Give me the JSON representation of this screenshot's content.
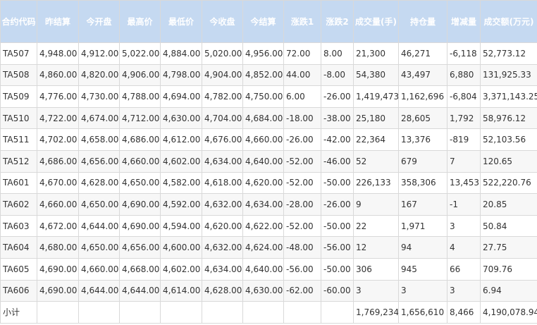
{
  "colors": {
    "header_bg": "#c5d9f1",
    "header_text": "#ffffff",
    "border": "#d9d9d9",
    "alt_row": "#f7f7f7"
  },
  "headers": [
    "合约代码",
    "昨结算",
    "今开盘",
    "最高价",
    "最低价",
    "今收盘",
    "今结算",
    "涨跌1",
    "涨跌2",
    "成交量(手)",
    "持仓量",
    "增减量",
    "成交额(万元)"
  ],
  "rows": [
    [
      "TA507",
      "4,948.00",
      "4,912.00",
      "5,022.00",
      "4,884.00",
      "5,020.00",
      "4,956.00",
      "72.00",
      "8.00",
      "21,300",
      "46,271",
      "-6,118",
      "52,773.12"
    ],
    [
      "TA508",
      "4,860.00",
      "4,820.00",
      "4,906.00",
      "4,798.00",
      "4,904.00",
      "4,852.00",
      "44.00",
      "-8.00",
      "54,380",
      "43,497",
      "6,880",
      "131,925.33"
    ],
    [
      "TA509",
      "4,776.00",
      "4,730.00",
      "4,788.00",
      "4,694.00",
      "4,782.00",
      "4,750.00",
      "6.00",
      "-26.00",
      "1,419,473",
      "1,162,696",
      "-6,804",
      "3,371,143.25"
    ],
    [
      "TA510",
      "4,722.00",
      "4,674.00",
      "4,712.00",
      "4,630.00",
      "4,704.00",
      "4,684.00",
      "-18.00",
      "-38.00",
      "25,180",
      "28,605",
      "1,792",
      "58,976.12"
    ],
    [
      "TA511",
      "4,702.00",
      "4,658.00",
      "4,686.00",
      "4,612.00",
      "4,676.00",
      "4,660.00",
      "-26.00",
      "-42.00",
      "22,364",
      "13,376",
      "-819",
      "52,103.56"
    ],
    [
      "TA512",
      "4,686.00",
      "4,656.00",
      "4,660.00",
      "4,602.00",
      "4,634.00",
      "4,640.00",
      "-52.00",
      "-46.00",
      "52",
      "679",
      "7",
      "120.65"
    ],
    [
      "TA601",
      "4,670.00",
      "4,628.00",
      "4,650.00",
      "4,582.00",
      "4,618.00",
      "4,620.00",
      "-52.00",
      "-50.00",
      "226,133",
      "358,306",
      "13,453",
      "522,220.76"
    ],
    [
      "TA602",
      "4,660.00",
      "4,650.00",
      "4,690.00",
      "4,592.00",
      "4,632.00",
      "4,634.00",
      "-28.00",
      "-26.00",
      "9",
      "167",
      "-1",
      "20.85"
    ],
    [
      "TA603",
      "4,672.00",
      "4,644.00",
      "4,690.00",
      "4,594.00",
      "4,620.00",
      "4,622.00",
      "-52.00",
      "-50.00",
      "22",
      "1,971",
      "3",
      "50.84"
    ],
    [
      "TA604",
      "4,680.00",
      "4,650.00",
      "4,656.00",
      "4,600.00",
      "4,632.00",
      "4,624.00",
      "-48.00",
      "-56.00",
      "12",
      "94",
      "4",
      "27.75"
    ],
    [
      "TA605",
      "4,690.00",
      "4,660.00",
      "4,668.00",
      "4,602.00",
      "4,634.00",
      "4,640.00",
      "-56.00",
      "-50.00",
      "306",
      "945",
      "66",
      "709.76"
    ],
    [
      "TA606",
      "4,690.00",
      "4,644.00",
      "4,644.00",
      "4,614.00",
      "4,628.00",
      "4,630.00",
      "-62.00",
      "-60.00",
      "3",
      "3",
      "3",
      "6.94"
    ],
    [
      "小计",
      "",
      "",
      "",
      "",
      "",
      "",
      "",
      "",
      "1,769,234",
      "1,656,610",
      "8,466",
      "4,190,078.94"
    ]
  ]
}
